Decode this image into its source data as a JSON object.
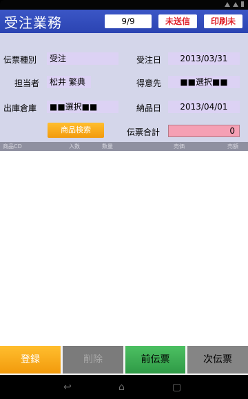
{
  "header": {
    "title": "受注業務",
    "counter": "9/9",
    "unsent_label": "未送信",
    "print_label": "印刷未"
  },
  "form": {
    "slip_type_label": "伝票種別",
    "slip_type_value": "受注",
    "order_date_label": "受注日",
    "order_date_value": "2013/03/31",
    "staff_label": "担当者",
    "staff_value": "松井 繁典",
    "customer_label": "得意先",
    "customer_value": "■■選択■■",
    "warehouse_label": "出庫倉庫",
    "warehouse_value": "■■選択■■",
    "delivery_date_label": "納品日",
    "delivery_date_value": "2013/04/01",
    "product_button_label": "商品検索",
    "total_label": "伝票合計",
    "total_value": "0"
  },
  "table": {
    "headers": [
      "商品CD",
      "入数",
      "数量",
      "売価",
      "売額"
    ]
  },
  "bottom": {
    "register_label": "登録",
    "delete_label": "削除",
    "prev_label": "前伝票",
    "next_label": "次伝票"
  },
  "colors": {
    "header_blue": "#2e48b6",
    "form_bg": "#d4d6ea",
    "field_purple": "#dcd2f4",
    "orange": "#f5a623",
    "total_pink": "#f5a0b4",
    "green": "#3aa850",
    "gray": "#8a8a8a",
    "red_text": "#e0242c"
  },
  "icons": [
    "wifi-icon",
    "signal-icon",
    "battery-icon",
    "back-icon",
    "home-icon",
    "recents-icon"
  ]
}
